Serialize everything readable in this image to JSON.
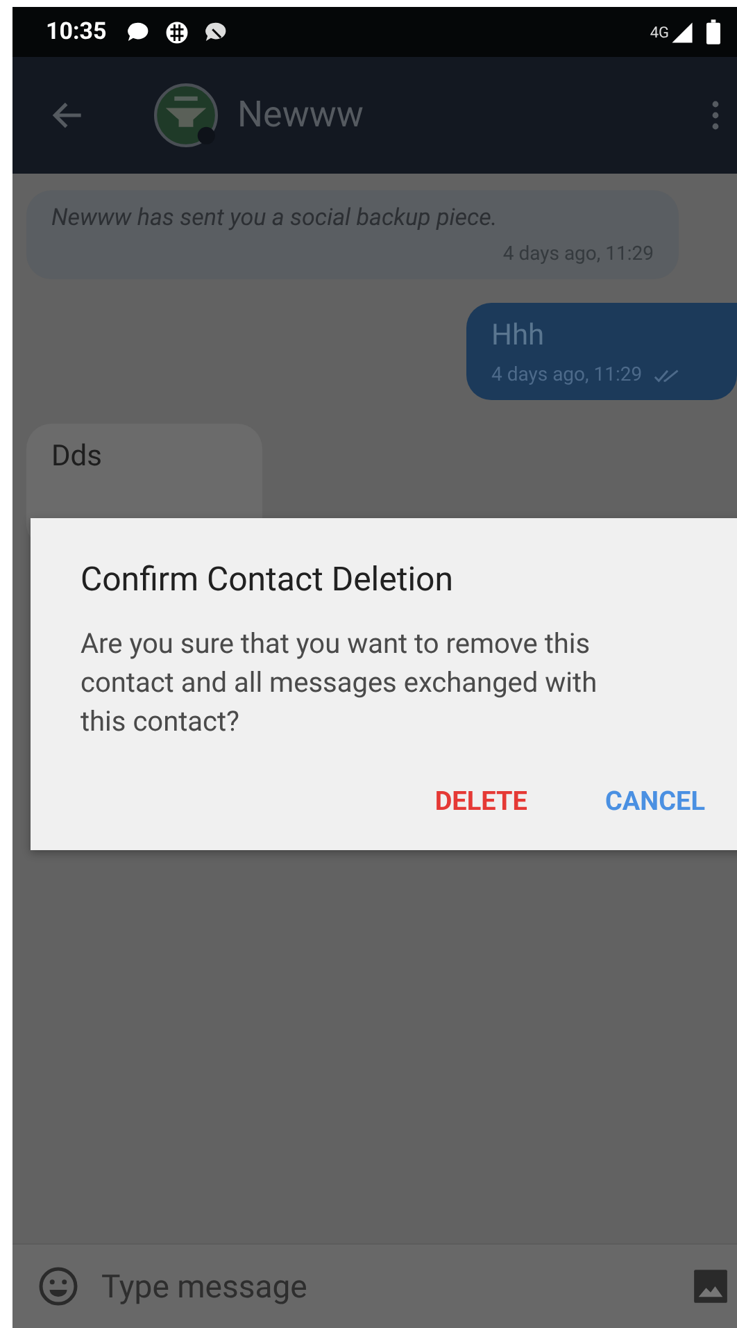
{
  "status_bar": {
    "time": "10:35",
    "network": "4G"
  },
  "toolbar": {
    "title": "Newww"
  },
  "messages": [
    {
      "kind": "system",
      "text": "Newww has sent you a social backup piece.",
      "time": "4 days ago, 11:29",
      "outgoing": false
    },
    {
      "kind": "text",
      "text": "Hhh",
      "time": "4 days ago, 11:29",
      "outgoing": true,
      "read": true
    },
    {
      "kind": "text",
      "text": "Dds",
      "outgoing": false
    }
  ],
  "dialog": {
    "title": "Confirm Contact Deletion",
    "message": "Are you sure that you want to remove this contact and all messages exchanged with this contact?",
    "buttons": [
      {
        "label": "DELETE",
        "kind": "destructive"
      },
      {
        "label": "CANCEL",
        "kind": "neutral"
      }
    ]
  },
  "composer": {
    "placeholder": "Type message"
  }
}
